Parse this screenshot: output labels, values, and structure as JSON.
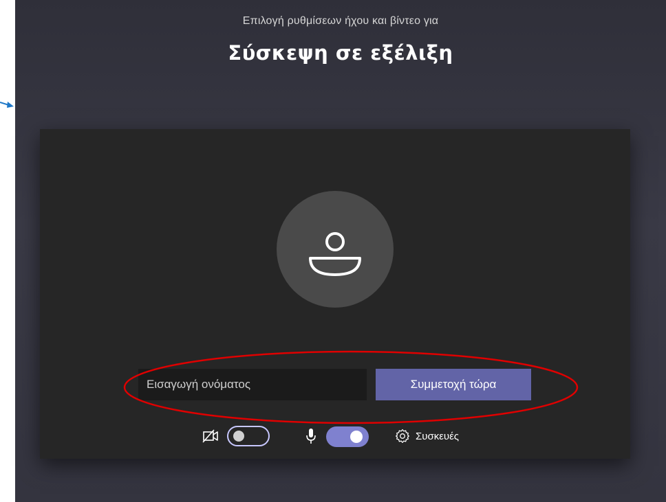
{
  "header": {
    "subtitle": "Επιλογή ρυθμίσεων ήχου και βίντεο για",
    "title": "Σύσκεψη σε εξέλιξη"
  },
  "join_form": {
    "name_placeholder": "Εισαγωγή ονόματος",
    "join_button_label": "Συμμετοχή τώρα"
  },
  "controls": {
    "camera": {
      "icon": "camera-off-icon",
      "state": "off"
    },
    "microphone": {
      "icon": "microphone-icon",
      "state": "on"
    },
    "devices": {
      "icon": "gear-icon",
      "label": "Συσκευές"
    }
  },
  "avatar": {
    "icon": "person-icon"
  },
  "colors": {
    "background": "#34343f",
    "panel": "#262626",
    "accent": "#6264a7",
    "toggle_on": "#7f81cf",
    "annotation_ellipse": "#e00000",
    "pointer_arrow": "#1f78c8"
  }
}
